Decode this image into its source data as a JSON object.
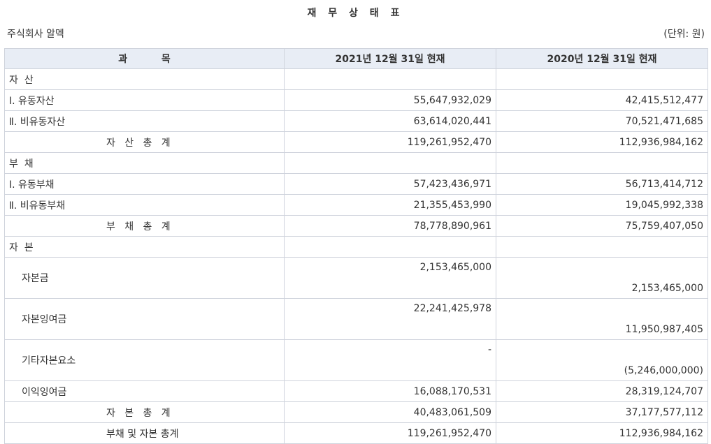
{
  "title": "재 무 상 태 표",
  "company": "주식회사 알멕",
  "unit": "(단위: 원)",
  "headers": [
    "과          목",
    "2021년 12월 31일 현재",
    "2020년 12월 31일 현재"
  ],
  "rows": [
    {
      "label": "자  산",
      "cur": "",
      "prev": ""
    },
    {
      "label": "Ⅰ. 유동자산",
      "cur": "55,647,932,029",
      "prev": "42,415,512,477"
    },
    {
      "label": "Ⅱ. 비유동자산",
      "cur": "63,614,020,441",
      "prev": "70,521,471,685"
    },
    {
      "label": "자   산   총   계",
      "cur": "119,261,952,470",
      "prev": "112,936,984,162"
    },
    {
      "label": "부  채",
      "cur": "",
      "prev": ""
    },
    {
      "label": "Ⅰ. 유동부채",
      "cur": "57,423,436,971",
      "prev": "56,713,414,712"
    },
    {
      "label": "Ⅱ. 비유동부채",
      "cur": "21,355,453,990",
      "prev": "19,045,992,338"
    },
    {
      "label": "부   채   총   계",
      "cur": "78,778,890,961",
      "prev": "75,759,407,050"
    },
    {
      "label": "자  본",
      "cur": "",
      "prev": ""
    },
    {
      "label": "자본금",
      "cur": "2,153,465,000",
      "prev": "2,153,465,000"
    },
    {
      "label": "자본잉여금",
      "cur": "22,241,425,978",
      "prev": "11,950,987,405"
    },
    {
      "label": "기타자본요소",
      "cur": "-",
      "prev": "(5,246,000,000)"
    },
    {
      "label": "이익잉여금",
      "cur": "16,088,170,531",
      "prev": "28,319,124,707"
    },
    {
      "label": "자   본   총   계",
      "cur": "40,483,061,509",
      "prev": "37,177,577,112"
    },
    {
      "label": "부채 및 자본 총계",
      "cur": "119,261,952,470",
      "prev": "112,936,984,162"
    }
  ]
}
